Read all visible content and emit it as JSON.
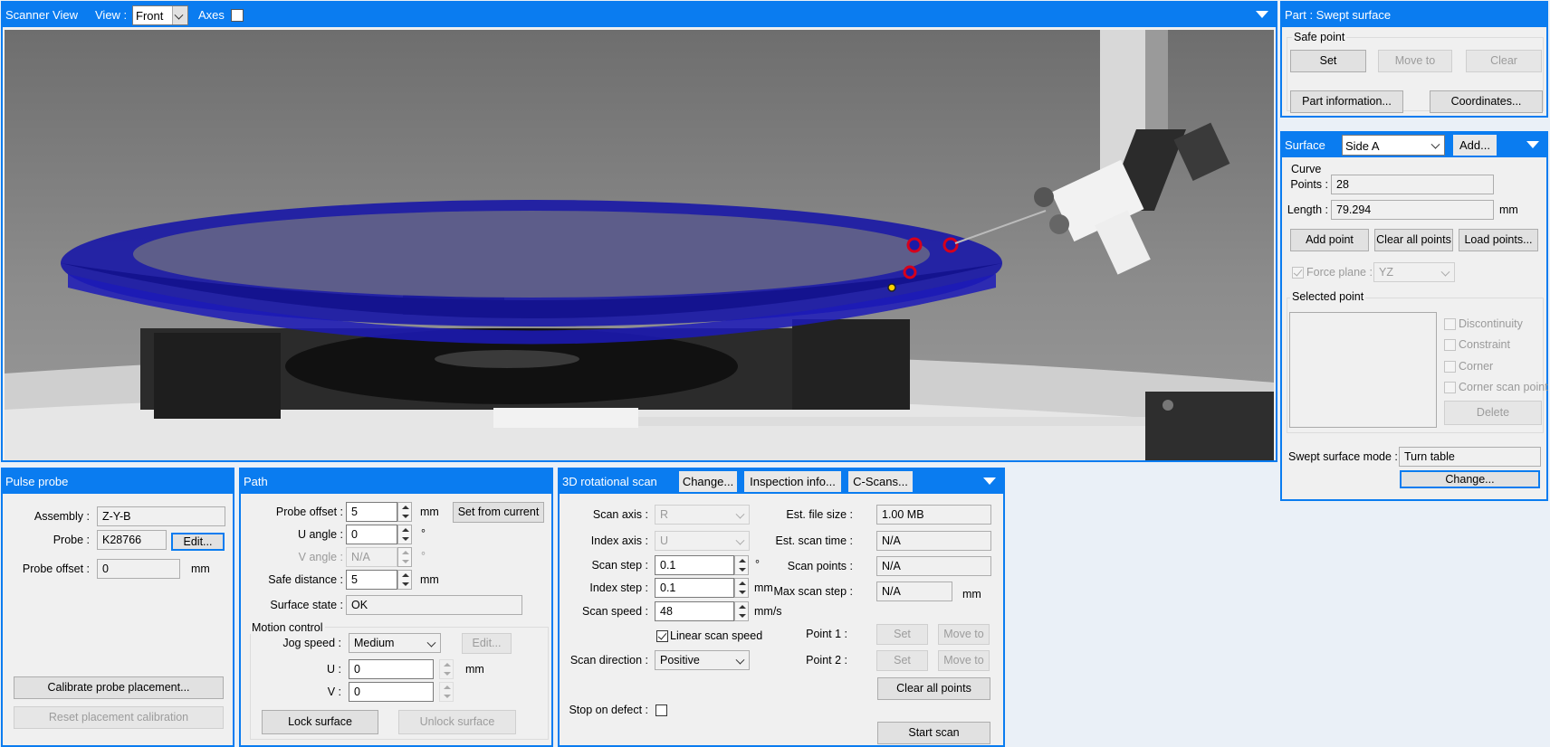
{
  "scanner_view": {
    "title": "Scanner View",
    "view_label": "View :",
    "view_value": "Front",
    "axes_label": "Axes",
    "axes_checked": false
  },
  "part_panel": {
    "title": "Part : Swept surface",
    "safe_point_label": "Safe point",
    "set": "Set",
    "move_to": "Move to",
    "clear": "Clear",
    "part_information": "Part information...",
    "coordinates": "Coordinates..."
  },
  "surface_panel": {
    "title": "Surface",
    "side_value": "Side A",
    "add": "Add...",
    "curve_label": "Curve",
    "points_label": "Points :",
    "points_value": "28",
    "length_label": "Length :",
    "length_value": "79.294",
    "length_unit": "mm",
    "add_point": "Add point",
    "clear_all_points": "Clear all points",
    "load_points": "Load points...",
    "force_plane_label": "Force plane :",
    "force_plane_checked": true,
    "force_plane_value": "YZ",
    "selected_point_label": "Selected point",
    "discontinuity": "Discontinuity",
    "constraint": "Constraint",
    "corner": "Corner",
    "corner_scan_point": "Corner scan point",
    "delete": "Delete",
    "swept_mode_label": "Swept surface mode :",
    "swept_mode_value": "Turn table",
    "change": "Change..."
  },
  "pulse_probe": {
    "title": "Pulse probe",
    "assembly_label": "Assembly :",
    "assembly_value": "Z-Y-B",
    "probe_label": "Probe :",
    "probe_value": "K28766",
    "edit": "Edit...",
    "probe_offset_label": "Probe offset :",
    "probe_offset_value": "0",
    "unit_mm": "mm",
    "calibrate": "Calibrate probe placement...",
    "reset": "Reset placement calibration"
  },
  "path": {
    "title": "Path",
    "probe_offset_label": "Probe offset :",
    "probe_offset_value": "5",
    "unit_mm": "mm",
    "set_from_current": "Set from current",
    "u_angle_label": "U angle :",
    "u_angle_value": "0",
    "deg": "°",
    "v_angle_label": "V angle :",
    "v_angle_value": "N/A",
    "safe_distance_label": "Safe distance :",
    "safe_distance_value": "5",
    "surface_state_label": "Surface state :",
    "surface_state_value": "OK",
    "motion_control_label": "Motion control",
    "jog_speed_label": "Jog speed :",
    "jog_speed_value": "Medium",
    "edit": "Edit...",
    "u_label": "U :",
    "u_value": "0",
    "v_label": "V :",
    "v_value": "0",
    "lock_surface": "Lock surface",
    "unlock_surface": "Unlock surface"
  },
  "rot_scan": {
    "title": "3D rotational scan",
    "change": "Change...",
    "inspection_info": "Inspection info...",
    "c_scans": "C-Scans...",
    "scan_axis_label": "Scan axis :",
    "scan_axis_value": "R",
    "index_axis_label": "Index axis :",
    "index_axis_value": "U",
    "scan_step_label": "Scan step :",
    "scan_step_value": "0.1",
    "deg": "°",
    "index_step_label": "Index step :",
    "index_step_value": "0.1",
    "mm": "mm",
    "scan_speed_label": "Scan speed :",
    "scan_speed_value": "48",
    "mms": "mm/s",
    "linear_scan_speed": "Linear scan speed",
    "linear_checked": true,
    "scan_direction_label": "Scan direction :",
    "scan_direction_value": "Positive",
    "stop_on_defect_label": "Stop on defect :",
    "stop_on_defect_checked": false,
    "est_file_size_label": "Est. file size :",
    "est_file_size_value": "1.00 MB",
    "est_scan_time_label": "Est. scan time :",
    "est_scan_time_value": "N/A",
    "scan_points_label": "Scan points :",
    "scan_points_value": "N/A",
    "max_scan_step_label": "Max scan step :",
    "max_scan_step_value": "N/A",
    "point1_label": "Point 1 :",
    "point2_label": "Point 2 :",
    "set": "Set",
    "move_to": "Move to",
    "clear_all_points": "Clear all points",
    "start_scan": "Start scan"
  },
  "colors": {
    "accent": "#0a7cf0",
    "ring": "#1d1aa8",
    "viewport_bg": "#8a8a8a"
  }
}
